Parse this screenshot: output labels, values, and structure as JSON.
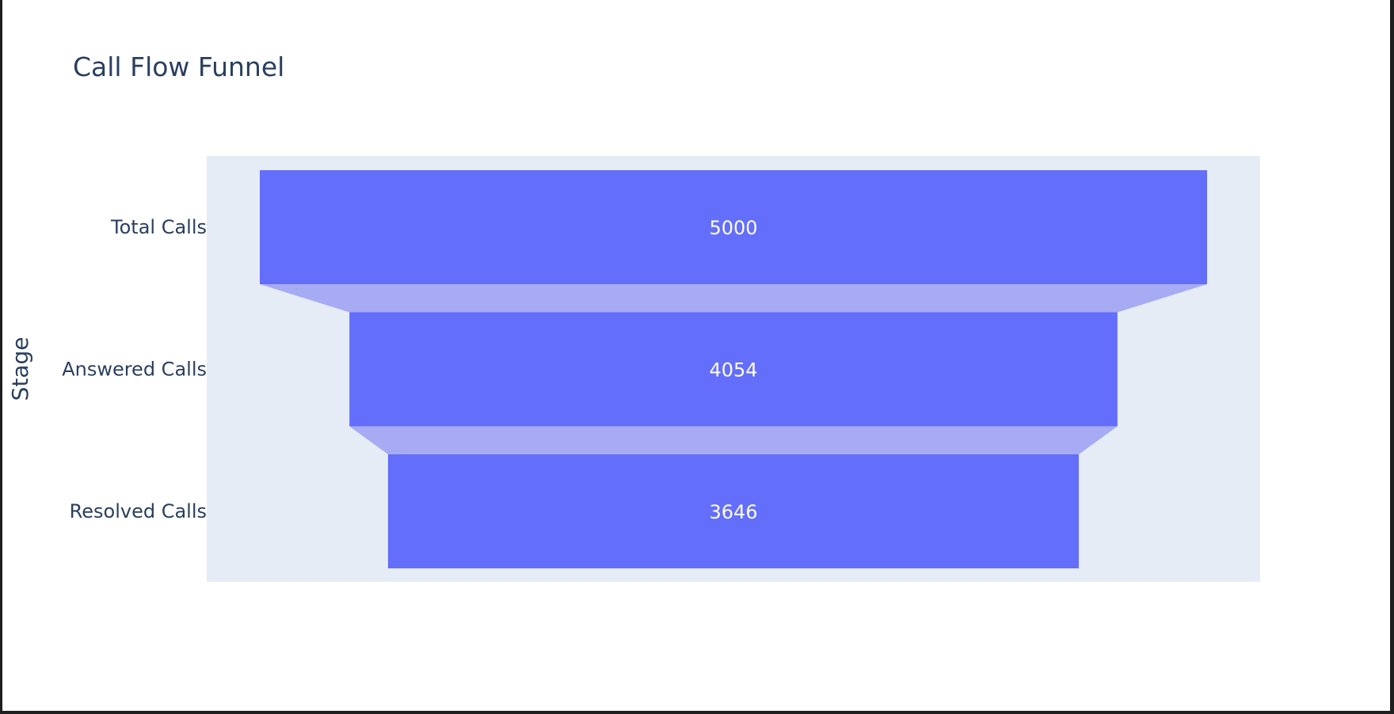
{
  "chart_data": {
    "type": "funnel",
    "title": "Call Flow Funnel",
    "ylabel": "Stage",
    "xlabel": "",
    "categories": [
      "Total Calls",
      "Answered Calls",
      "Resolved Calls"
    ],
    "values": [
      5000,
      4054,
      3646
    ],
    "text_labels": [
      "5000",
      "4054",
      "3646"
    ],
    "legend": false,
    "grid": false,
    "colors": {
      "bar": "#636efa",
      "connector": "#a7abf3",
      "plot_background": "#e5ecf6",
      "paper_background": "#ffffff",
      "text": "#2a3f5f",
      "value_text": "#ffffff"
    }
  }
}
